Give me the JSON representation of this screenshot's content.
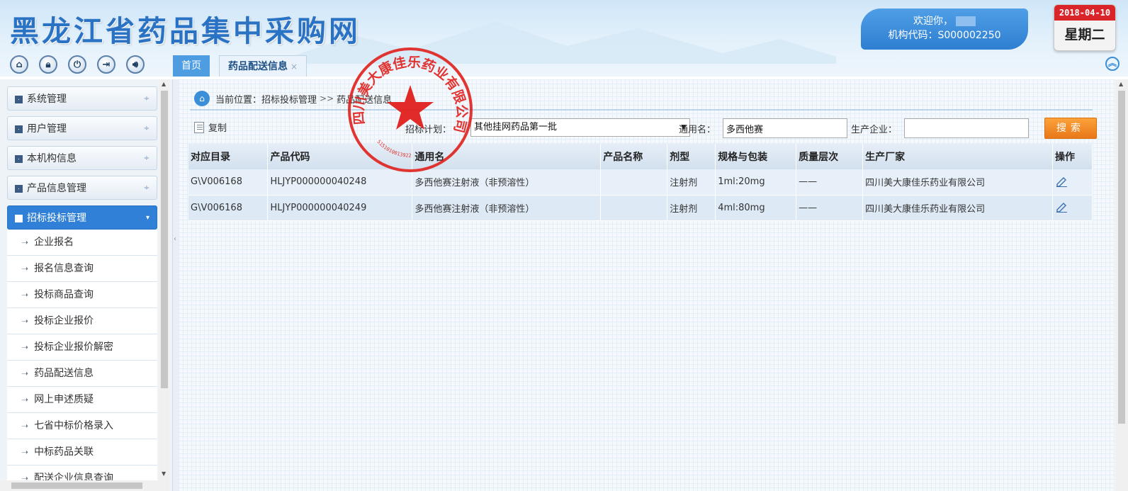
{
  "header": {
    "site_title": "黑龙江省药品集中采购网",
    "welcome_text": "欢迎你，",
    "org_code": "机构代码：S000002250",
    "date": "2018-04-10",
    "weekday": "星期二"
  },
  "toolbar_icons": [
    "home-icon",
    "lock-icon",
    "power-icon",
    "logout-icon",
    "sound-icon"
  ],
  "tabs": {
    "home": "首页",
    "active": "药品配送信息",
    "close": "×"
  },
  "sidebar": {
    "groups": [
      {
        "label": "系统管理",
        "arrow": "÷"
      },
      {
        "label": "用户管理",
        "arrow": "÷"
      },
      {
        "label": "本机构信息",
        "arrow": "÷"
      },
      {
        "label": "产品信息管理",
        "arrow": "÷"
      },
      {
        "label": "招标投标管理",
        "arrow": "▾"
      }
    ],
    "sub_items": [
      "企业报名",
      "报名信息查询",
      "投标商品查询",
      "投标企业报价",
      "投标企业报价解密",
      "药品配送信息",
      "网上申述质疑",
      "七省中标价格录入",
      "中标药品关联",
      "配送企业信息查询"
    ],
    "sub_arrow": "➝"
  },
  "breadcrumb": {
    "prefix": "当前位置：",
    "level1": "招标投标管理",
    "sep": ">>",
    "level2": "药品配送信息"
  },
  "filters": {
    "copy_label": "复制",
    "plan_label": "招标计划：",
    "plan_value": "其他挂网药品第一批",
    "generic_label": "通用名：",
    "generic_value": "多西他赛",
    "manufacturer_label": "生产企业：",
    "manufacturer_value": "",
    "search_label": "搜索"
  },
  "table": {
    "columns": [
      "对应目录",
      "产品代码",
      "通用名",
      "产品名称",
      "剂型",
      "规格与包装",
      "质量层次",
      "生产厂家",
      "操作"
    ],
    "rows": [
      {
        "catalog": "G\\V006168",
        "code": "HLJYP000000040248",
        "generic": "多西他赛注射液（非预溶性）",
        "name": "",
        "form": "注射剂",
        "spec": "1ml:20mg",
        "quality": "——",
        "maker": "四川美大康佳乐药业有限公司"
      },
      {
        "catalog": "G\\V006168",
        "code": "HLJYP000000040249",
        "generic": "多西他赛注射液（非预溶性）",
        "name": "",
        "form": "注射剂",
        "spec": "4ml:80mg",
        "quality": "——",
        "maker": "四川美大康佳乐药业有限公司"
      }
    ]
  },
  "seal": {
    "text": "四川美大康佳乐药业有限公司",
    "number": "5151010013922",
    "color": "#e0201c"
  }
}
